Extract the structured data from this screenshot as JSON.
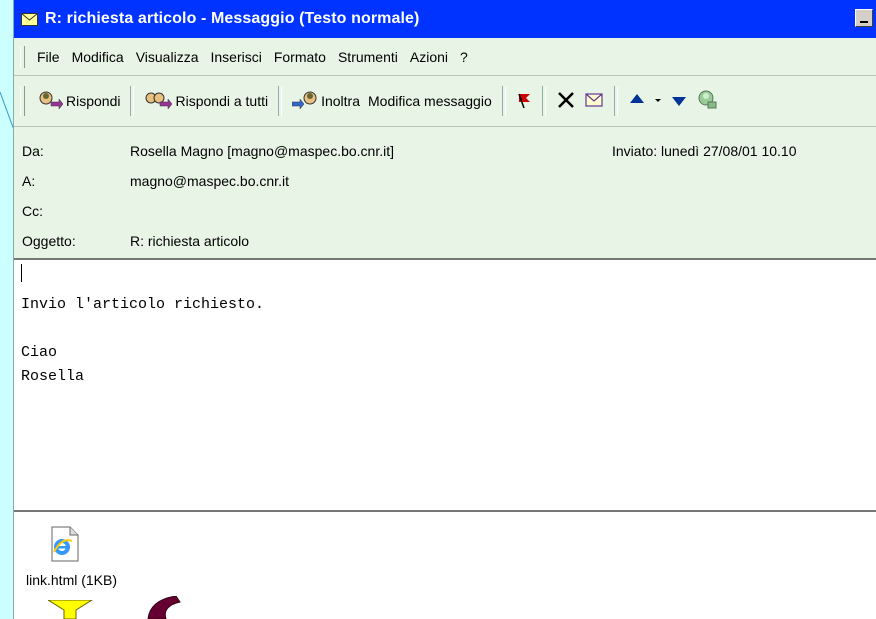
{
  "window": {
    "title": "R: richiesta articolo - Messaggio (Testo normale)"
  },
  "menu": [
    "File",
    "Modifica",
    "Visualizza",
    "Inserisci",
    "Formato",
    "Strumenti",
    "Azioni",
    "?"
  ],
  "toolbar": {
    "reply": "Rispondi",
    "reply_all": "Rispondi a tutti",
    "forward": "Inoltra",
    "edit_message": "Modifica messaggio"
  },
  "header": {
    "from_label": "Da:",
    "from_value": "Rosella Magno [magno@maspec.bo.cnr.it]",
    "to_label": "A:",
    "to_value": "magno@maspec.bo.cnr.it",
    "cc_label": "Cc:",
    "cc_value": "",
    "subject_label": "Oggetto:",
    "subject_value": "R: richiesta articolo",
    "sent_label": "Inviato:",
    "sent_value": "lunedì 27/08/01 10.10"
  },
  "body": {
    "lines": [
      "Invio l'articolo richiesto.",
      "",
      "Ciao",
      "Rosella"
    ]
  },
  "attachment": {
    "name": "link.html (1KB)"
  },
  "colors": {
    "titlebar": "#0033ff",
    "window_bg": "#e8f5e6",
    "page_bg": "#ccffff"
  }
}
